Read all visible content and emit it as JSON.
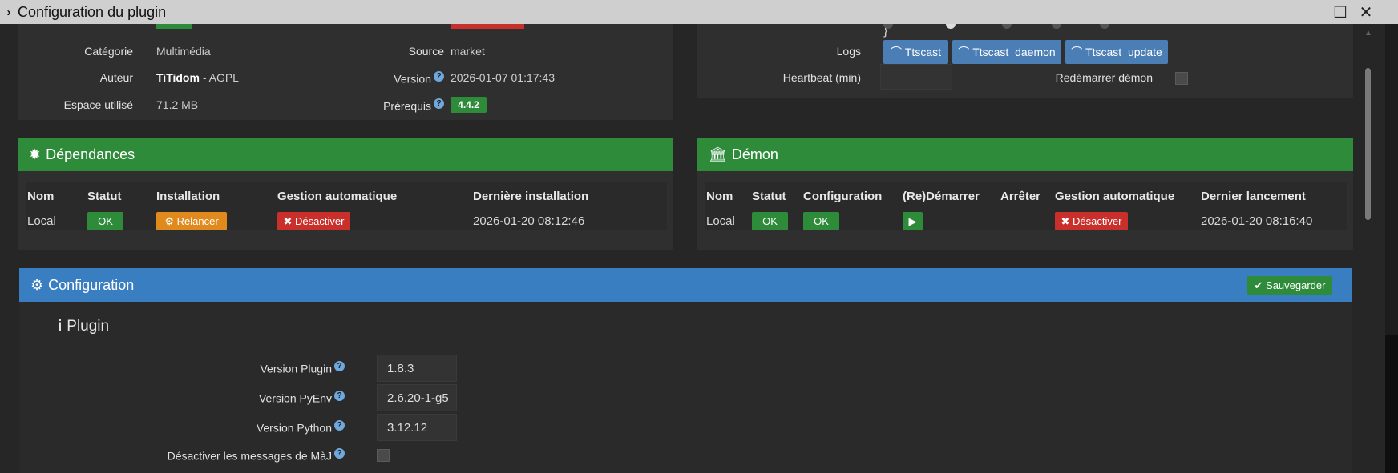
{
  "window": {
    "title": "Configuration du plugin"
  },
  "info": {
    "categorie_label": "Catégorie",
    "categorie_value": "Multimédia",
    "auteur_label": "Auteur",
    "auteur_name": "TiTidom",
    "auteur_license": " - AGPL",
    "espace_label": "Espace utilisé",
    "espace_value": "71.2 MB",
    "source_label": "Source",
    "source_value": "market",
    "version_label": "Version",
    "version_value": "2026-01-07 01:17:43",
    "prerequis_label": "Prérequis",
    "prerequis_value": "4.4.2"
  },
  "logs": {
    "label": "Logs",
    "buttons": [
      "Ttscast",
      "Ttscast_daemon",
      "Ttscast_update"
    ],
    "heartbeat_label": "Heartbeat (min)",
    "restart_label": "Redémarrer démon"
  },
  "dependances": {
    "title": "Dépendances",
    "headers": [
      "Nom",
      "Statut",
      "Installation",
      "Gestion automatique",
      "Dernière installation"
    ],
    "row": {
      "nom": "Local",
      "statut": "OK",
      "installation": "Relancer",
      "gestion": "Désactiver",
      "derniere": "2026-01-20 08:12:46"
    }
  },
  "demon": {
    "title": "Démon",
    "headers": [
      "Nom",
      "Statut",
      "Configuration",
      "(Re)Démarrer",
      "Arrêter",
      "Gestion automatique",
      "Dernier lancement"
    ],
    "row": {
      "nom": "Local",
      "statut": "OK",
      "configuration": "OK",
      "gestion": "Désactiver",
      "dernier": "2026-01-20 08:16:40"
    }
  },
  "configuration": {
    "title": "Configuration",
    "save_label": "Sauvegarder",
    "section_title": "Plugin",
    "fields": [
      {
        "label": "Version Plugin",
        "value": "1.8.3"
      },
      {
        "label": "Version PyEnv",
        "value": "2.6.20-1-g5"
      },
      {
        "label": "Version Python",
        "value": "3.12.12"
      }
    ],
    "disable_updates_label": "Désactiver les messages de MàJ"
  },
  "colors": {
    "green": "#2e8b3a",
    "blue": "#3a7ec2",
    "red": "#c9302c",
    "orange": "#e08a1e"
  }
}
